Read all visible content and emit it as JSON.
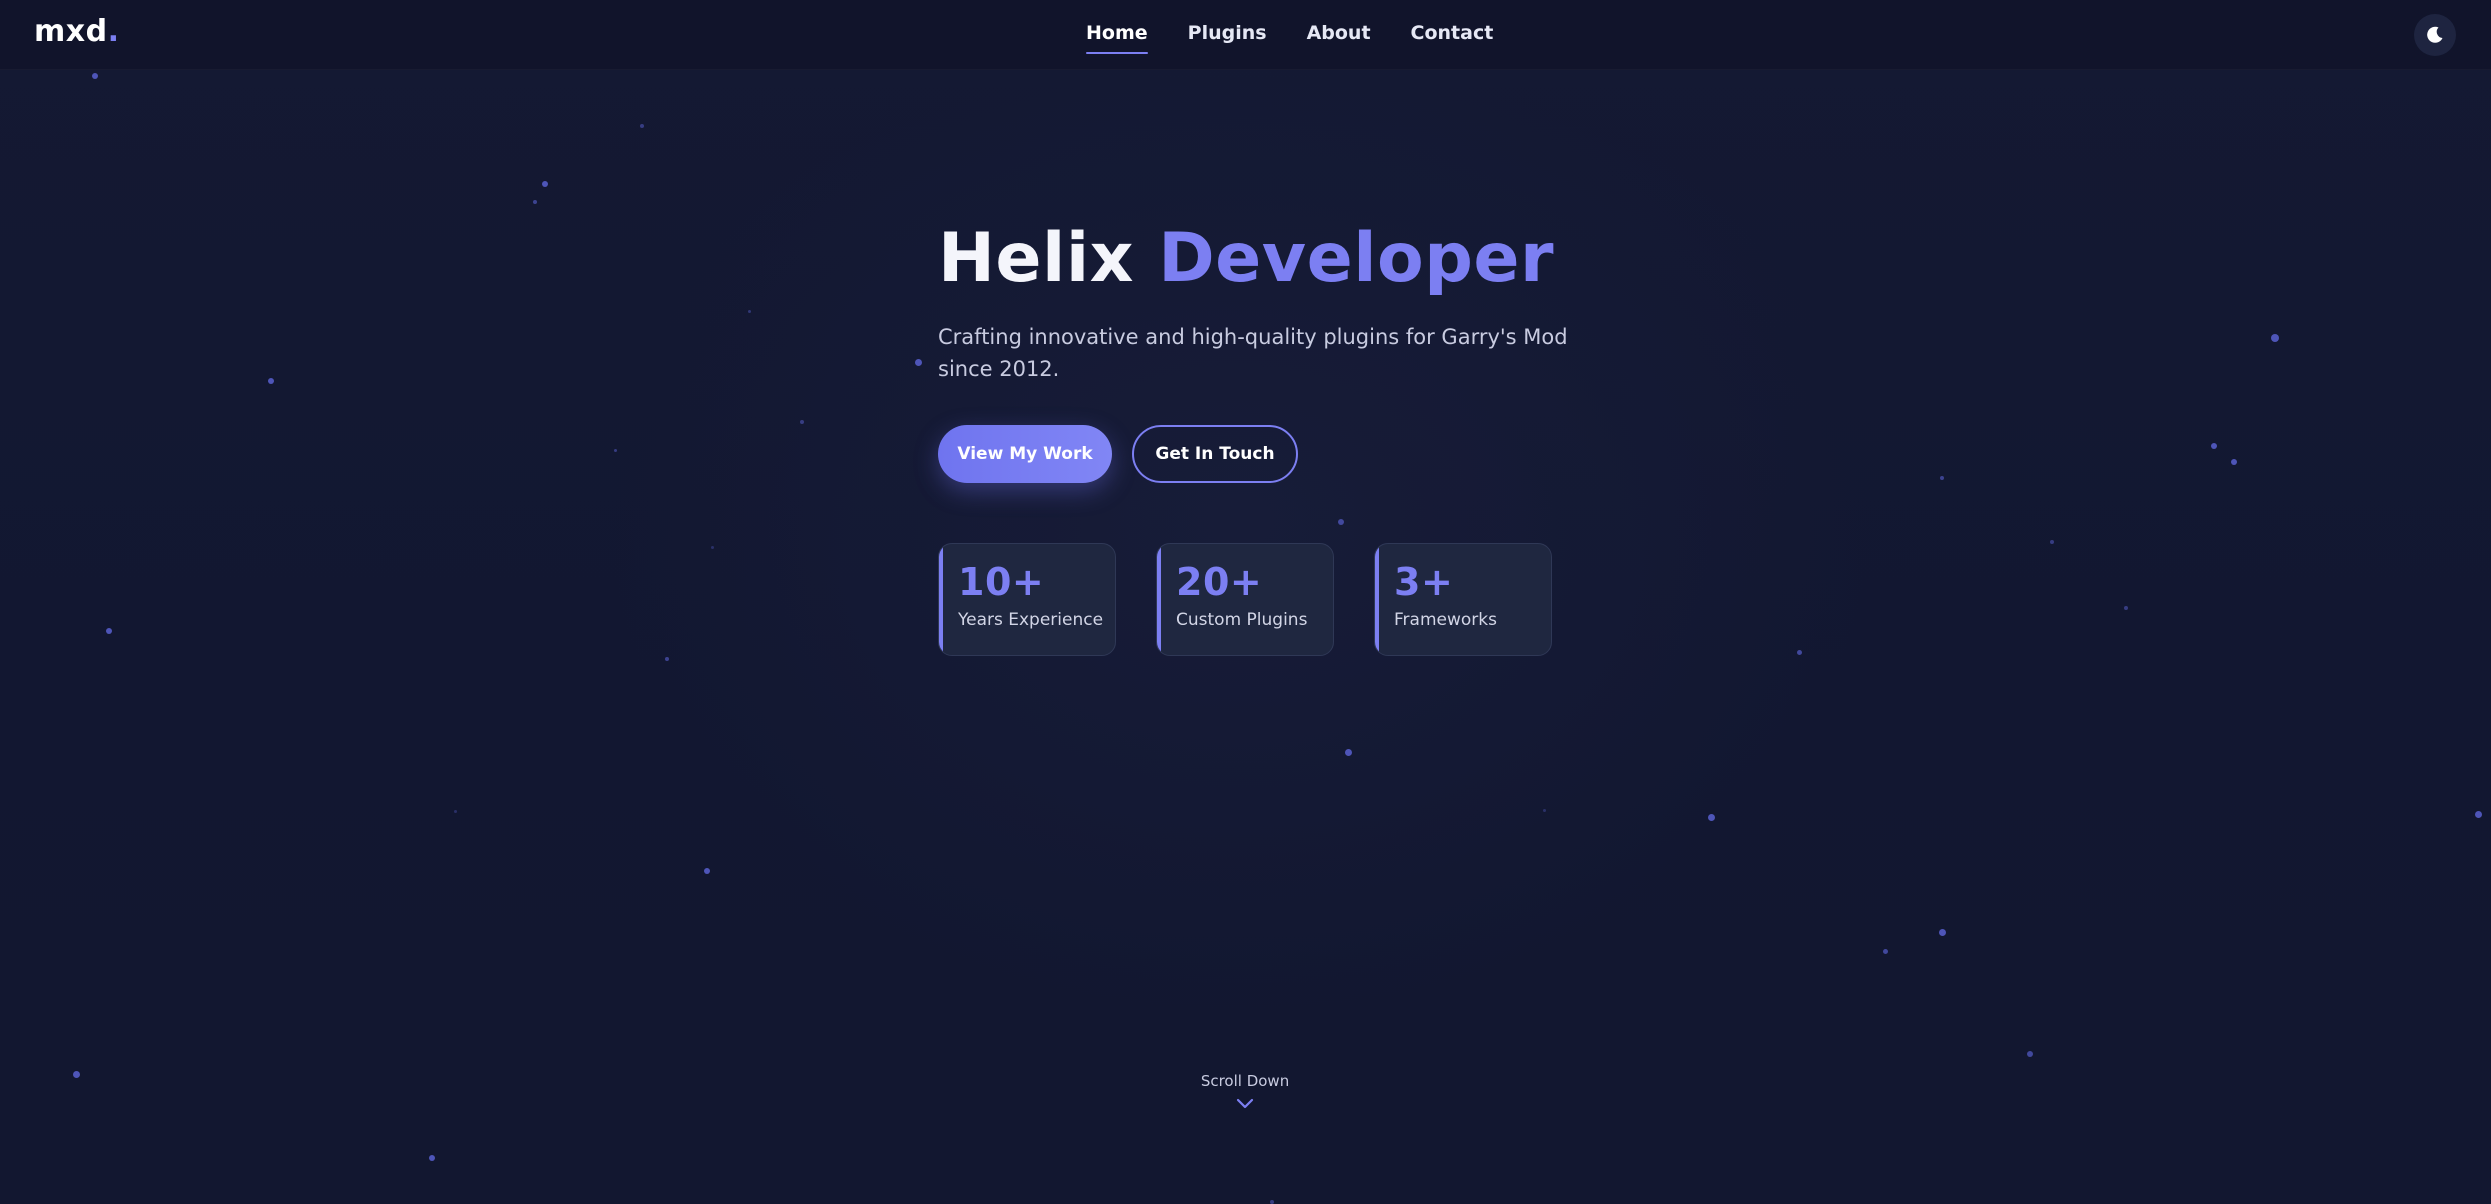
{
  "brand": {
    "logo_text": "mxd",
    "logo_dot": "."
  },
  "nav": {
    "items": [
      {
        "label": "Home",
        "active": true
      },
      {
        "label": "Plugins",
        "active": false
      },
      {
        "label": "About",
        "active": false
      },
      {
        "label": "Contact",
        "active": false
      }
    ]
  },
  "theme_toggle": {
    "icon": "moon-icon"
  },
  "hero": {
    "title_plain": "Helix ",
    "title_accent": "Developer",
    "subtitle": "Crafting innovative and high-quality plugins for Garry's Mod since 2012.",
    "primary_button": "View My Work",
    "secondary_button": "Get In Touch"
  },
  "stats": [
    {
      "value": "10+",
      "label": "Years Experience"
    },
    {
      "value": "20+",
      "label": "Custom Plugins"
    },
    {
      "value": "3+",
      "label": "Frameworks"
    }
  ],
  "scroll": {
    "label": "Scroll Down",
    "icon": "chevron-down-icon"
  },
  "colors": {
    "accent": "#7c7ff2",
    "background": "#131831",
    "card": "#1f2740"
  }
}
